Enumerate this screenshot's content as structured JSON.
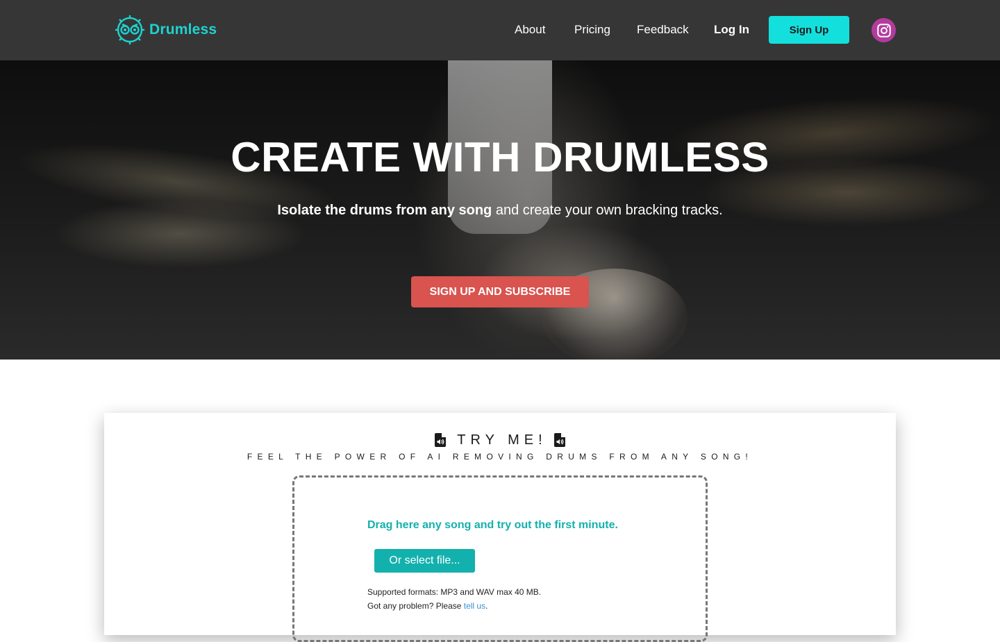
{
  "nav": {
    "brand": "Drumless",
    "links": [
      {
        "label": "About"
      },
      {
        "label": "Pricing"
      },
      {
        "label": "Feedback"
      }
    ],
    "login_label": "Log In",
    "signup_label": "Sign Up",
    "social_icon": "instagram-icon"
  },
  "hero": {
    "title": "CREATE WITH DRUMLESS",
    "subtitle_bold": "Isolate the drums from any song",
    "subtitle_rest": " and create your own bracking tracks.",
    "cta_label": "SIGN UP AND SUBSCRIBE"
  },
  "try": {
    "heading": "TRY ME!",
    "heading_icon": "audio-file-icon",
    "subheading": "FEEL THE POWER OF AI REMOVING DRUMS FROM ANY SONG!",
    "drop_text": "Drag here any song and try out the first minute.",
    "select_label": "Or select file...",
    "formats_text": "Supported formats: MP3 and WAV max 40 MB.",
    "problem_text": "Got any problem? Please ",
    "problem_link": "tell us",
    "problem_end": "."
  },
  "colors": {
    "nav_bg": "#363636",
    "accent": "#13e0dc",
    "teal": "#13b1ad",
    "cta_red": "#d9534f",
    "instagram": "#b43b9e"
  }
}
